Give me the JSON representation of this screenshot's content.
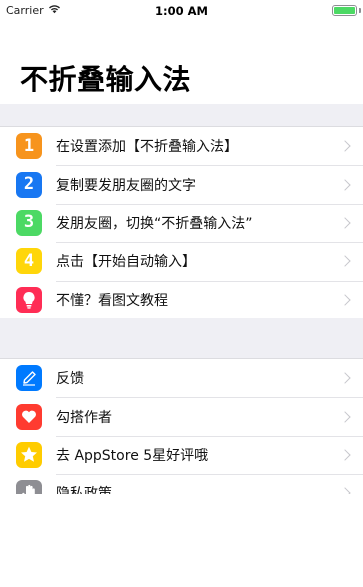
{
  "status_bar": {
    "carrier": "Carrier",
    "time": "1:00 AM"
  },
  "title": "不折叠输入法",
  "section1": [
    {
      "number": "1",
      "label": "在设置添加【不折叠输入法】",
      "color": "#f7941d"
    },
    {
      "number": "2",
      "label": "复制要发朋友圈的文字",
      "color": "#1877f2"
    },
    {
      "number": "3",
      "label": "发朋友圈，切换“不折叠输入法”",
      "color": "#4cd964"
    },
    {
      "number": "4",
      "label": "点击【开始自动输入】",
      "color": "#ffd60a"
    },
    {
      "icon": "lightbulb-icon",
      "label": "不懂？看图文教程",
      "color": "#ff2d55"
    }
  ],
  "section2": [
    {
      "icon": "pen-icon",
      "label": "反馈",
      "color": "#007aff"
    },
    {
      "icon": "heart-icon",
      "label": "勾搭作者",
      "color": "#ff3b30"
    },
    {
      "icon": "star-icon",
      "label": "去 AppStore 5星好评哦",
      "color": "#ffcc00"
    },
    {
      "icon": "hand-icon",
      "label": "隐私政策",
      "color": "#8e8e93"
    }
  ]
}
